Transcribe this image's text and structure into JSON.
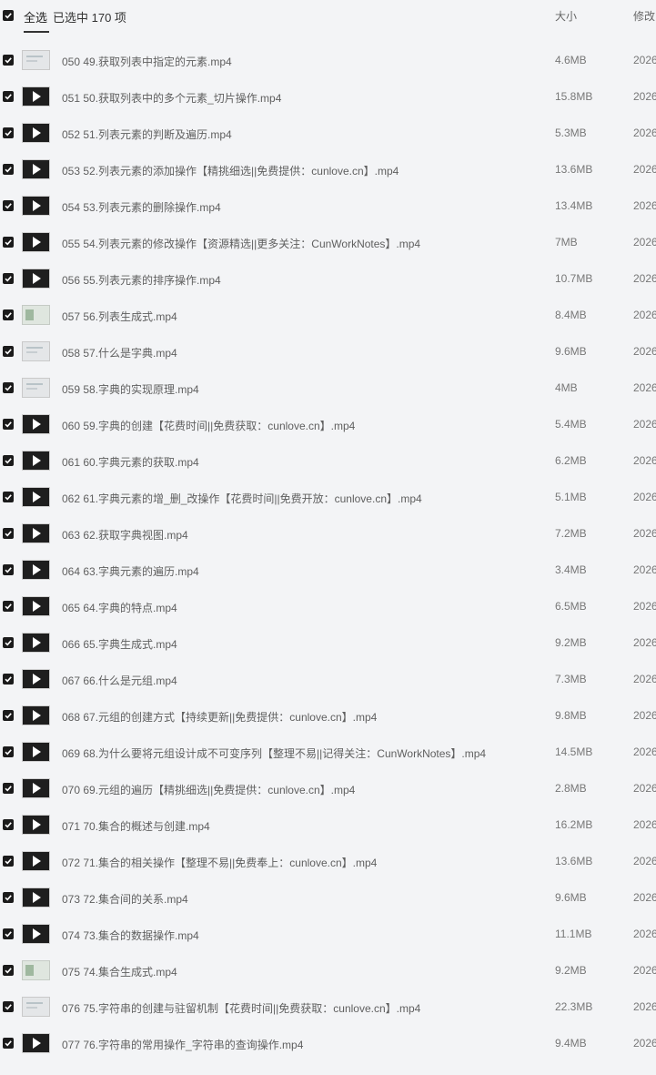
{
  "header": {
    "select_all": "全选",
    "selected_text": "已选中  170  项",
    "col_size": "大小",
    "col_modified": "修改"
  },
  "files": [
    {
      "name": "050 49.获取列表中指定的元素.mp4",
      "size": "4.6MB",
      "date": "2026",
      "thumb": "light"
    },
    {
      "name": "051 50.获取列表中的多个元素_切片操作.mp4",
      "size": "15.8MB",
      "date": "2026",
      "thumb": "dark"
    },
    {
      "name": "052 51.列表元素的判断及遍历.mp4",
      "size": "5.3MB",
      "date": "2026",
      "thumb": "dark"
    },
    {
      "name": "053 52.列表元素的添加操作【精挑细选||免费提供：cunlove.cn】.mp4",
      "size": "13.6MB",
      "date": "2026",
      "thumb": "dark"
    },
    {
      "name": "054 53.列表元素的删除操作.mp4",
      "size": "13.4MB",
      "date": "2026",
      "thumb": "dark"
    },
    {
      "name": "055 54.列表元素的修改操作【资源精选||更多关注：CunWorkNotes】.mp4",
      "size": "7MB",
      "date": "2026",
      "thumb": "dark"
    },
    {
      "name": "056 55.列表元素的排序操作.mp4",
      "size": "10.7MB",
      "date": "2026",
      "thumb": "dark"
    },
    {
      "name": "057 56.列表生成式.mp4",
      "size": "8.4MB",
      "date": "2026",
      "thumb": "green"
    },
    {
      "name": "058 57.什么是字典.mp4",
      "size": "9.6MB",
      "date": "2026",
      "thumb": "light"
    },
    {
      "name": "059 58.字典的实现原理.mp4",
      "size": "4MB",
      "date": "2026",
      "thumb": "light"
    },
    {
      "name": "060 59.字典的创建【花费时间||免费获取：cunlove.cn】.mp4",
      "size": "5.4MB",
      "date": "2026",
      "thumb": "dark"
    },
    {
      "name": "061 60.字典元素的获取.mp4",
      "size": "6.2MB",
      "date": "2026",
      "thumb": "dark"
    },
    {
      "name": "062 61.字典元素的增_删_改操作【花费时间||免费开放：cunlove.cn】.mp4",
      "size": "5.1MB",
      "date": "2026",
      "thumb": "dark"
    },
    {
      "name": "063 62.获取字典视图.mp4",
      "size": "7.2MB",
      "date": "2026",
      "thumb": "dark"
    },
    {
      "name": "064 63.字典元素的遍历.mp4",
      "size": "3.4MB",
      "date": "2026",
      "thumb": "dark"
    },
    {
      "name": "065 64.字典的特点.mp4",
      "size": "6.5MB",
      "date": "2026",
      "thumb": "dark"
    },
    {
      "name": "066 65.字典生成式.mp4",
      "size": "9.2MB",
      "date": "2026",
      "thumb": "dark"
    },
    {
      "name": "067 66.什么是元组.mp4",
      "size": "7.3MB",
      "date": "2026",
      "thumb": "dark"
    },
    {
      "name": "068 67.元组的创建方式【持续更新||免费提供：cunlove.cn】.mp4",
      "size": "9.8MB",
      "date": "2026",
      "thumb": "dark"
    },
    {
      "name": "069 68.为什么要将元组设计成不可变序列【整理不易||记得关注：CunWorkNotes】.mp4",
      "size": "14.5MB",
      "date": "2026",
      "thumb": "dark"
    },
    {
      "name": "070 69.元组的遍历【精挑细选||免费提供：cunlove.cn】.mp4",
      "size": "2.8MB",
      "date": "2026",
      "thumb": "dark"
    },
    {
      "name": "071 70.集合的概述与创建.mp4",
      "size": "16.2MB",
      "date": "2026",
      "thumb": "dark"
    },
    {
      "name": "072 71.集合的相关操作【整理不易||免费奉上：cunlove.cn】.mp4",
      "size": "13.6MB",
      "date": "2026",
      "thumb": "dark"
    },
    {
      "name": "073 72.集合间的关系.mp4",
      "size": "9.6MB",
      "date": "2026",
      "thumb": "dark"
    },
    {
      "name": "074 73.集合的数据操作.mp4",
      "size": "11.1MB",
      "date": "2026",
      "thumb": "dark"
    },
    {
      "name": "075 74.集合生成式.mp4",
      "size": "9.2MB",
      "date": "2026",
      "thumb": "green"
    },
    {
      "name": "076 75.字符串的创建与驻留机制【花费时间||免费获取：cunlove.cn】.mp4",
      "size": "22.3MB",
      "date": "2026",
      "thumb": "light"
    },
    {
      "name": "077 76.字符串的常用操作_字符串的查询操作.mp4",
      "size": "9.4MB",
      "date": "2026",
      "thumb": "dark"
    }
  ]
}
